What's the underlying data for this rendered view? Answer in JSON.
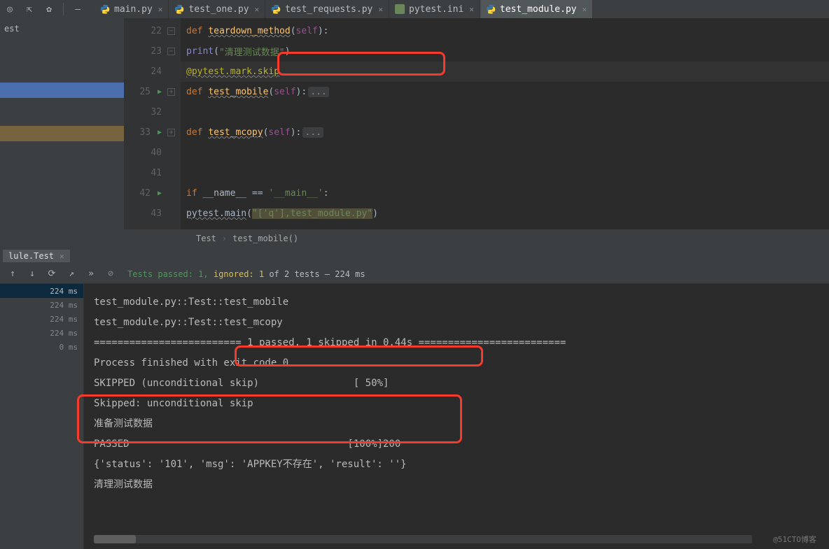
{
  "tabs": [
    {
      "name": "main.py",
      "active": false,
      "kind": "py"
    },
    {
      "name": "test_one.py",
      "active": false,
      "kind": "py"
    },
    {
      "name": "test_requests.py",
      "active": false,
      "kind": "py"
    },
    {
      "name": "pytest.ini",
      "active": false,
      "kind": "ini"
    },
    {
      "name": "test_module.py",
      "active": true,
      "kind": "py"
    }
  ],
  "sidebar": {
    "header": "est"
  },
  "code_lines": {
    "l22": {
      "ln": "22",
      "run": false,
      "fold": "-"
    },
    "l23": {
      "ln": "23",
      "run": false,
      "fold": "-"
    },
    "l24": {
      "ln": "24",
      "run": false,
      "fold": ""
    },
    "l25": {
      "ln": "25",
      "run": true,
      "fold": "+"
    },
    "l32": {
      "ln": "32",
      "run": false,
      "fold": ""
    },
    "l33": {
      "ln": "33",
      "run": true,
      "fold": "+"
    },
    "l40": {
      "ln": "40",
      "run": false,
      "fold": ""
    },
    "l41": {
      "ln": "41",
      "run": false,
      "fold": ""
    },
    "l42": {
      "ln": "42",
      "run": true,
      "fold": ""
    },
    "l43": {
      "ln": "43",
      "run": false,
      "fold": ""
    }
  },
  "code": {
    "def": "def ",
    "if": "if ",
    "teardown": "teardown_method",
    "self": "self",
    "print": "print",
    "teardown_sig": "(",
    "teardown_sig2": "):",
    "print_open": "(",
    "print_str": "\"清理测试数据\"",
    "print_close": ")",
    "decorator": "@pytest.mark.skip",
    "test_mobile": "test_mobile",
    "sig_open": "(",
    "sig_close": "):",
    "dots": "...",
    "test_mcopy": "test_mcopy",
    "name_eq": "__name__ == ",
    "main_str": "'__main__'",
    "main_colon": ":",
    "pytest_main": "pytest.main",
    "main_open": "(",
    "main_arg": "\"['q'],test_module.py\"",
    "main_close": ")"
  },
  "breadcrumb": {
    "a": "Test",
    "b": "test_mobile()"
  },
  "tool_tab": "lule.Test",
  "runner": {
    "passed_label": "Tests passed: ",
    "passed_count": "1, ",
    "ignored_label": "ignored: 1",
    "of": " of 2 tests – 224 ms"
  },
  "tree_times": [
    "224 ms",
    "224 ms",
    "224 ms",
    "224 ms",
    "0 ms"
  ],
  "console": {
    "l1": "test_module.py::Test::test_mobile",
    "l2": "test_module.py::Test::test_mcopy",
    "l3": "",
    "l4": "========================= 1 passed, 1 skipped in 0.44s =========================",
    "l5": "",
    "l6": "Process finished with exit code 0",
    "l7": "SKIPPED (unconditional skip)                [ 50%]",
    "l8": "Skipped: unconditional skip",
    "l9": "准备测试数据",
    "l10": "PASSED                                     [100%]200",
    "l11": "{'status': '101', 'msg': 'APPKEY不存在', 'result': ''}",
    "l12": "清理测试数据"
  },
  "watermark": "@51CTO博客"
}
